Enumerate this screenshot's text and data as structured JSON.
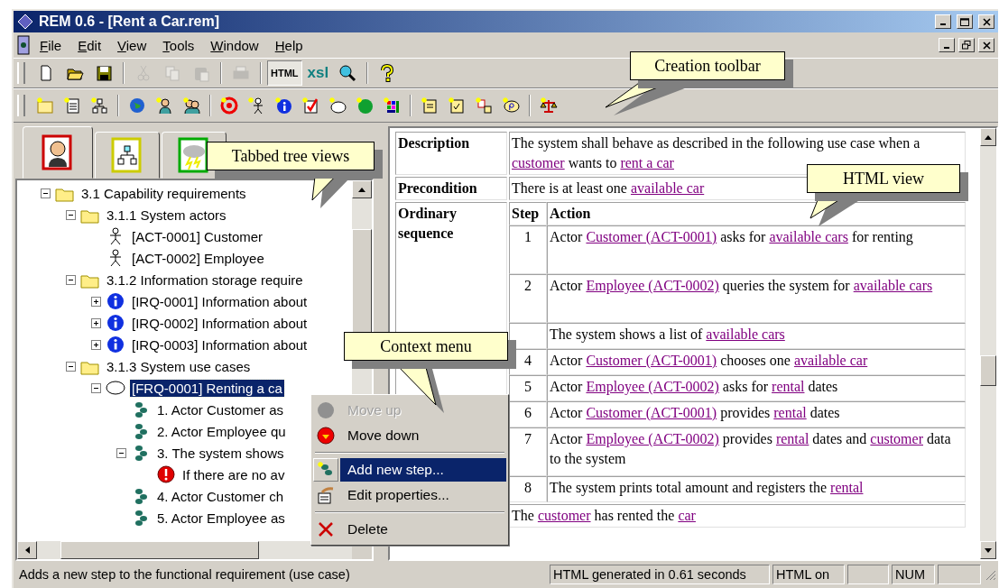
{
  "window": {
    "title": "REM 0.6 - [Rent a Car.rem]"
  },
  "menu": [
    "File",
    "Edit",
    "View",
    "Tools",
    "Window",
    "Help"
  ],
  "main_toolbar": [
    [
      {
        "disabled": false
      },
      {
        "disabled": false
      },
      {
        "disabled": false
      }
    ],
    [
      {
        "disabled": true
      },
      {
        "disabled": true
      },
      {
        "disabled": true
      }
    ],
    [
      {
        "disabled": true
      }
    ],
    [
      {
        "label": "HTML",
        "pressed": true
      },
      {
        "label": "xsl",
        "pressed": false
      },
      {
        "disabled": false
      }
    ],
    [
      {
        "disabled": false
      }
    ]
  ],
  "tree_tabs": [
    {
      "selected": true
    },
    {
      "selected": false
    },
    {
      "selected": false
    }
  ],
  "tree": {
    "items": [
      {
        "label": "3.1 Capability requirements",
        "kind": "folder",
        "expanded": true,
        "selected": false,
        "children": [
          {
            "label": "3.1.1 System actors",
            "kind": "folder",
            "expanded": true,
            "selected": false,
            "children": [
              {
                "label": "[ACT-0001] Customer",
                "kind": "actor",
                "selected": false
              },
              {
                "label": "[ACT-0002] Employee",
                "kind": "actor",
                "selected": false
              }
            ]
          },
          {
            "label": "3.1.2 Information storage require",
            "kind": "folder",
            "expanded": true,
            "selected": false,
            "children": [
              {
                "label": "[IRQ-0001] Information about",
                "kind": "info",
                "expanded": false,
                "selected": false
              },
              {
                "label": "[IRQ-0002] Information about",
                "kind": "info",
                "expanded": false,
                "selected": false
              },
              {
                "label": "[IRQ-0003] Information about",
                "kind": "info",
                "expanded": false,
                "selected": false
              }
            ]
          },
          {
            "label": "3.1.3 System use cases",
            "kind": "folder",
            "expanded": true,
            "selected": false,
            "children": [
              {
                "label": "[FRQ-0001] Renting a ca",
                "kind": "usecase",
                "expanded": true,
                "selected": true,
                "children": [
                  {
                    "label": "1. Actor Customer as",
                    "kind": "step",
                    "selected": false
                  },
                  {
                    "label": "2. Actor Employee qu",
                    "kind": "step",
                    "selected": false
                  },
                  {
                    "label": "3. The system shows",
                    "kind": "step",
                    "expanded": true,
                    "selected": false,
                    "children": [
                      {
                        "label": "If there are no av",
                        "kind": "exception",
                        "selected": false
                      }
                    ]
                  },
                  {
                    "label": "4. Actor Customer ch",
                    "kind": "step",
                    "selected": false
                  },
                  {
                    "label": "5. Actor Employee as",
                    "kind": "step",
                    "selected": false
                  }
                ]
              }
            ]
          }
        ]
      }
    ]
  },
  "html_view": {
    "rows": [
      {
        "label": "Description",
        "content": [
          {
            "text": "The system shall behave as described in the following use case when a ",
            "link": false
          },
          {
            "text": "customer",
            "link": true
          },
          {
            "text": " wants to ",
            "link": false
          },
          {
            "text": "rent a car",
            "link": true
          }
        ]
      },
      {
        "label": "Precondition",
        "content": [
          {
            "text": "There is at least one ",
            "link": false
          },
          {
            "text": "available car",
            "link": true
          }
        ]
      },
      {
        "label": "Ordinary sequence",
        "columns": [
          "Step",
          "Action"
        ],
        "steps": [
          {
            "number": "1",
            "action": [
              {
                "text": "Actor ",
                "link": false
              },
              {
                "text": "Customer (ACT-0001)",
                "link": true
              },
              {
                "text": " asks for ",
                "link": false
              },
              {
                "text": "available cars",
                "link": true
              },
              {
                "text": " for renting",
                "link": false
              }
            ]
          },
          {
            "number": "2",
            "action": [
              {
                "text": "Actor ",
                "link": false
              },
              {
                "text": "Employee (ACT-0002)",
                "link": true
              },
              {
                "text": " queries the system for ",
                "link": false
              },
              {
                "text": "available cars",
                "link": true
              }
            ]
          },
          {
            "action": [
              {
                "text": "The system shows a list of ",
                "link": false
              },
              {
                "text": "available cars",
                "link": true
              }
            ]
          },
          {
            "number": "4",
            "action": [
              {
                "text": "Actor ",
                "link": false
              },
              {
                "text": "Customer (ACT-0001)",
                "link": true
              },
              {
                "text": " chooses one ",
                "link": false
              },
              {
                "text": "available car",
                "link": true
              }
            ]
          },
          {
            "number": "5",
            "action": [
              {
                "text": "Actor ",
                "link": false
              },
              {
                "text": "Employee (ACT-0002)",
                "link": true
              },
              {
                "text": " asks for ",
                "link": false
              },
              {
                "text": "rental",
                "link": true
              },
              {
                "text": " dates",
                "link": false
              }
            ]
          },
          {
            "number": "6",
            "action": [
              {
                "text": "Actor ",
                "link": false
              },
              {
                "text": "Customer (ACT-0001)",
                "link": true
              },
              {
                "text": " provides ",
                "link": false
              },
              {
                "text": "rental",
                "link": true
              },
              {
                "text": " dates",
                "link": false
              }
            ]
          },
          {
            "number": "7",
            "action": [
              {
                "text": "Actor ",
                "link": false
              },
              {
                "text": "Employee (ACT-0002)",
                "link": true
              },
              {
                "text": " provides ",
                "link": false
              },
              {
                "text": "rental",
                "link": true
              },
              {
                "text": " dates and ",
                "link": false
              },
              {
                "text": "customer",
                "link": true
              },
              {
                "text": " data to the system",
                "link": false
              }
            ]
          },
          {
            "number": "8",
            "action": [
              {
                "text": "The system prints total amount and registers the ",
                "link": false
              },
              {
                "text": "rental",
                "link": true
              }
            ]
          }
        ]
      },
      {
        "content": [
          {
            "text": "The ",
            "link": false
          },
          {
            "text": "customer",
            "link": true
          },
          {
            "text": " has rented the ",
            "link": false
          },
          {
            "text": "car",
            "link": true
          }
        ]
      }
    ]
  },
  "context_menu": {
    "items": [
      {
        "kind": "item",
        "label": "Move up",
        "disabled": true,
        "selected": false
      },
      {
        "kind": "item",
        "label": "Move down",
        "disabled": false,
        "selected": false
      },
      {
        "kind": "separator"
      },
      {
        "kind": "item",
        "label": "Add new step...",
        "disabled": false,
        "selected": true
      },
      {
        "kind": "item",
        "label": "Edit properties...",
        "disabled": false,
        "selected": false
      },
      {
        "kind": "separator"
      },
      {
        "kind": "item",
        "label": "Delete",
        "disabled": false,
        "selected": false
      }
    ]
  },
  "callouts": [
    "Creation toolbar",
    "Tabbed tree views",
    "HTML view",
    "Context menu"
  ],
  "status_bar": {
    "message": "Adds a new step to the functional requirement (use case)",
    "panels": [
      "HTML generated in 0.61 seconds",
      "HTML on",
      "NUM"
    ]
  }
}
